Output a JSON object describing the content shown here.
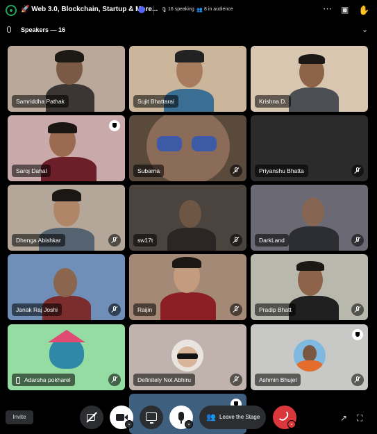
{
  "header": {
    "title": "🚀 Web 3.0, Blockchain, Startup & More...",
    "speaking": "16 speaking",
    "audience": "8 in audience"
  },
  "speakers_header": {
    "label": "Speakers — 16"
  },
  "tiles": [
    {
      "name": "Samriddha Pathak"
    },
    {
      "name": "Sujit Bhattarai"
    },
    {
      "name": "Krishna D."
    },
    {
      "name": "Saroj Dahal"
    },
    {
      "name": "Subarna"
    },
    {
      "name": "Priyanshu Bhatta"
    },
    {
      "name": "Dhenga Abishkar"
    },
    {
      "name": "sw17t"
    },
    {
      "name": "DarkLand"
    },
    {
      "name": "Janak Raj Joshi"
    },
    {
      "name": "Raijin"
    },
    {
      "name": "Pradip Bhatt"
    },
    {
      "name": "Adarsha pokharel"
    },
    {
      "name": "Definitely Not Abhiru"
    },
    {
      "name": "Ashmin Bhujel"
    }
  ],
  "controls": {
    "invite": "Invite",
    "leave_stage": "Leave the Stage"
  },
  "colors": {
    "accent": "#5865f2",
    "danger": "#da373c",
    "online": "#23a55a"
  }
}
